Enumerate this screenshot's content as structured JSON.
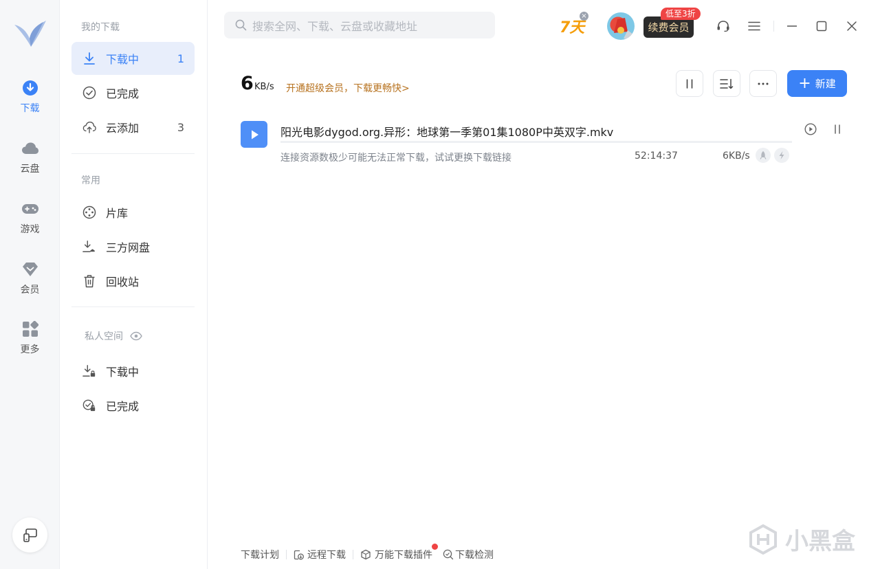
{
  "rail": {
    "items": [
      {
        "label": "下载",
        "icon": "download-circle-icon",
        "active": true
      },
      {
        "label": "云盘",
        "icon": "cloud-icon"
      },
      {
        "label": "游戏",
        "icon": "gamepad-icon"
      },
      {
        "label": "会员",
        "icon": "diamond-icon"
      },
      {
        "label": "更多",
        "icon": "apps-grid-icon"
      }
    ]
  },
  "sidebar": {
    "my_downloads_title": "我的下载",
    "downloading": {
      "label": "下载中",
      "count": "1"
    },
    "completed": {
      "label": "已完成"
    },
    "cloud_added": {
      "label": "云添加",
      "count": "3"
    },
    "common_title": "常用",
    "library": {
      "label": "片库"
    },
    "third_party": {
      "label": "三方网盘"
    },
    "trash": {
      "label": "回收站"
    },
    "private_title": "私人空间",
    "private_downloading": {
      "label": "下载中"
    },
    "private_completed": {
      "label": "已完成"
    }
  },
  "topbar": {
    "search_placeholder": "搜索全网、下载、云盘或收藏地址",
    "promo_days": "7天",
    "renew_label": "续费会员",
    "discount_badge": "低至3折"
  },
  "speed": {
    "value": "6",
    "unit": "KB/s",
    "upsell": "开通超级会员，下载更畅快>"
  },
  "toolbar": {
    "new_label": "新建"
  },
  "task": {
    "name": "阳光电影dygod.org.异形：地球第一季第01集1080P中英双字.mkv",
    "status": "连接资源数极少可能无法正常下载，试试更换下载链接",
    "time_left": "52:14:37",
    "speed": "6KB/s",
    "progress": 0.0
  },
  "bottom": {
    "plan": "下载计划",
    "remote": "远程下载",
    "plugin": "万能下载插件",
    "check": "下载检测"
  },
  "watermark": "小黑盒",
  "colors": {
    "accent": "#3b82f6",
    "upsell": "#b7721f",
    "badge": "#ef4444"
  }
}
